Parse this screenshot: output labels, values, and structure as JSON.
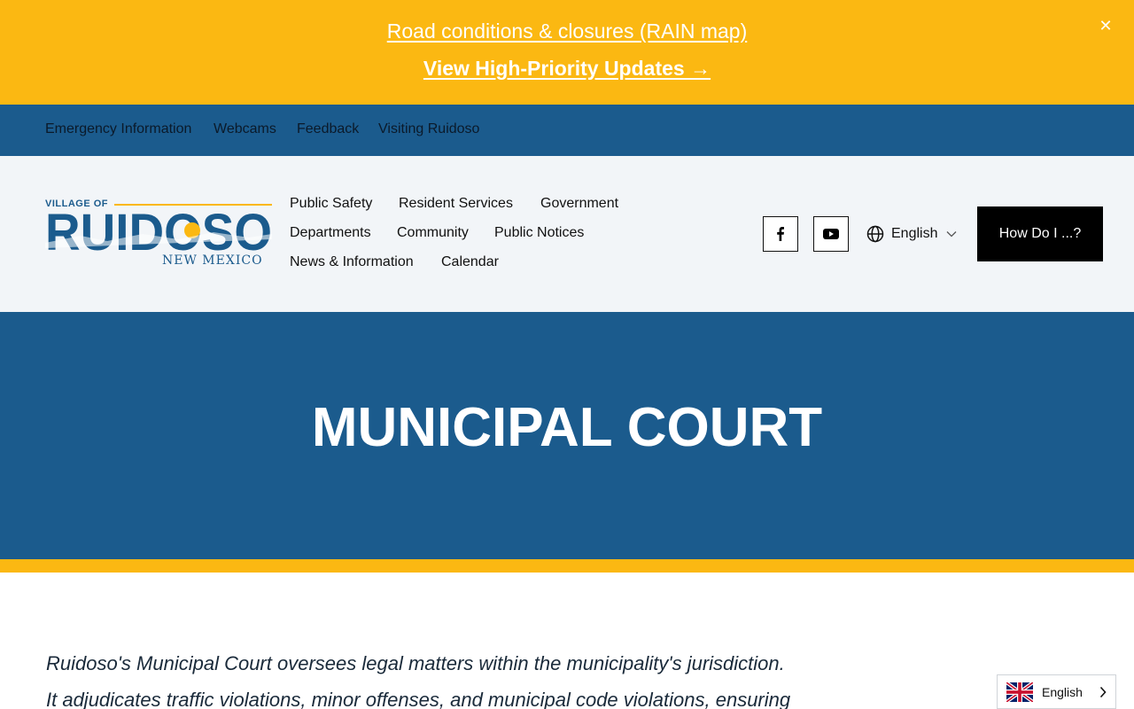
{
  "alert": {
    "link1": "Road conditions & closures (RAIN map)",
    "link2": "View High-Priority Updates →",
    "close_icon": "close-icon"
  },
  "utility_nav": [
    "Emergency Information",
    "Webcams",
    "Feedback",
    "Visiting Ruidoso"
  ],
  "logo": {
    "top_text": "VILLAGE OF",
    "name": "RUIDOSO",
    "sub_text": "NEW MEXICO"
  },
  "main_nav": [
    "Public Safety",
    "Resident Services",
    "Government",
    "Departments",
    "Community",
    "Public Notices",
    "News & Information",
    "Calendar"
  ],
  "social": {
    "facebook": "facebook-icon",
    "youtube": "youtube-icon"
  },
  "language": {
    "selected": "English",
    "icon": "globe-icon"
  },
  "how_do_i": "How Do I ...?",
  "hero": {
    "title": "MUNICIPAL COURT"
  },
  "intro": {
    "line1": "Ruidoso's Municipal Court oversees legal matters within the municipality's jurisdiction.",
    "line2": "It adjudicates traffic violations, minor offenses, and municipal code violations, ensuring"
  },
  "language_widget": {
    "label": "English",
    "flag_icon": "uk-flag-icon"
  },
  "colors": {
    "accent_yellow": "#fbb812",
    "brand_blue": "#1b5b8d",
    "header_bg": "#f2f5f8"
  }
}
